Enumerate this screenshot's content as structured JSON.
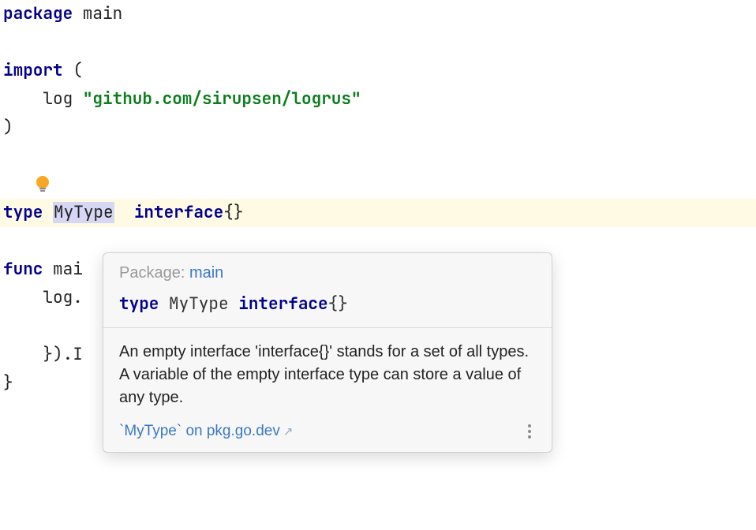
{
  "code": {
    "l1_kw": "package",
    "l1_name": " main",
    "l3_kw": "import",
    "l3_paren": " (",
    "l4_indent": "    ",
    "l4_alias": "log ",
    "l4_path": "\"github.com/sirupsen/logrus\"",
    "l5_close": ")",
    "l7_t1": "type",
    "l7_sp1": " ",
    "l7_name": "MyType",
    "l7_sp2": "  ",
    "l7_t2": "interface",
    "l7_braces": "{}",
    "l9_kw": "func",
    "l9_rest": " mai",
    "l10_indent": "    ",
    "l10_rest": "log.",
    "l12_indent": "    ",
    "l12_rest": "}).I",
    "l13_brace": "}"
  },
  "popup": {
    "pkg_label": "Package: ",
    "pkg_name": "main",
    "sig_t1": "type",
    "sig_name": " MyType ",
    "sig_t2": "interface",
    "sig_braces": "{}",
    "body": "An empty interface 'interface{}' stands for a set of all types. A variable of the empty interface type can store a value of any type.",
    "link_text": "`MyType` on pkg.go.dev",
    "arrow": "↗"
  }
}
